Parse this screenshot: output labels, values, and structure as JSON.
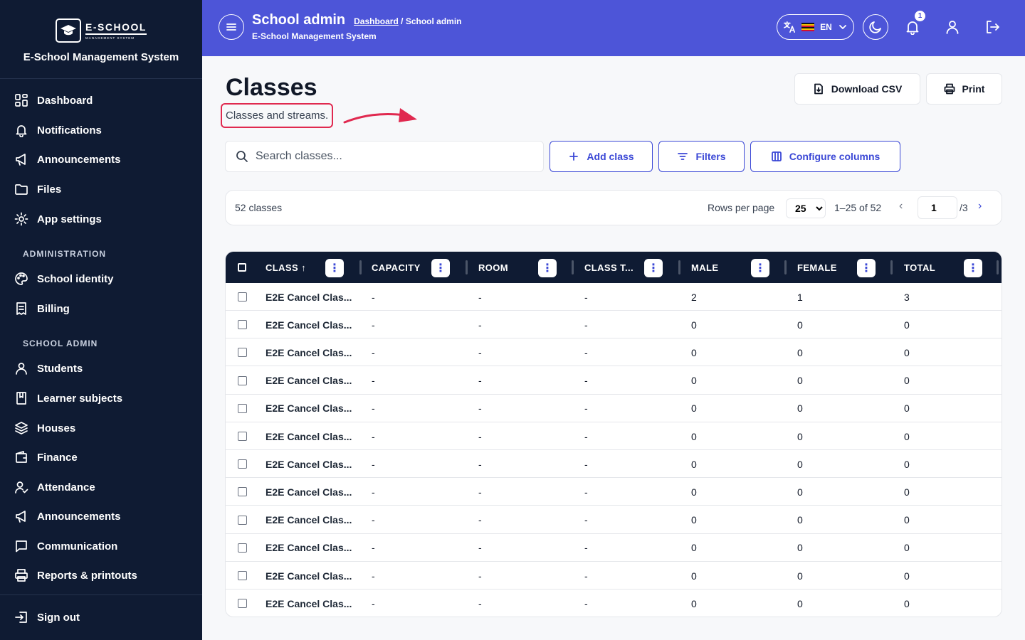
{
  "sidebar": {
    "logo_main": "E-SCHOOL",
    "logo_sub": "MANAGEMENT SYSTEM",
    "system_name": "E-School Management System",
    "items_main": [
      {
        "label": "Dashboard",
        "icon": "dashboard-icon"
      },
      {
        "label": "Notifications",
        "icon": "bell-icon"
      },
      {
        "label": "Announcements",
        "icon": "megaphone-icon"
      },
      {
        "label": "Files",
        "icon": "folder-icon"
      },
      {
        "label": "App settings",
        "icon": "gear-icon"
      }
    ],
    "section_admin": "ADMINISTRATION",
    "items_admin": [
      {
        "label": "School identity",
        "icon": "palette-icon"
      },
      {
        "label": "Billing",
        "icon": "receipt-icon"
      }
    ],
    "section_school": "SCHOOL ADMIN",
    "items_school": [
      {
        "label": "Students",
        "icon": "user-icon"
      },
      {
        "label": "Learner subjects",
        "icon": "book-icon"
      },
      {
        "label": "Houses",
        "icon": "layers-icon"
      },
      {
        "label": "Finance",
        "icon": "wallet-icon"
      },
      {
        "label": "Attendance",
        "icon": "user-check-icon"
      },
      {
        "label": "Announcements",
        "icon": "megaphone-icon"
      },
      {
        "label": "Communication",
        "icon": "message-icon"
      },
      {
        "label": "Reports & printouts",
        "icon": "printer-icon"
      }
    ],
    "sign_out": "Sign out"
  },
  "topbar": {
    "title": "School admin",
    "breadcrumb_link": "Dashboard",
    "breadcrumb_current": " / School admin",
    "subtitle": "E-School Management System",
    "language": "EN",
    "notification_count": "1",
    "accent_color": "#4d55d8"
  },
  "main": {
    "title": "Classes",
    "subtitle": "Classes and streams.",
    "download_csv": "Download CSV",
    "print": "Print",
    "search_placeholder": "Search classes...",
    "add_class": "Add class",
    "filters": "Filters",
    "configure_columns": "Configure columns"
  },
  "pager": {
    "count": "52 classes",
    "rows_per_page_label": "Rows per page",
    "rows_per_page": "25",
    "range": "1–25 of 52",
    "page": "1",
    "total_pages": "/3"
  },
  "table": {
    "columns": [
      "CLASS ↑",
      "CAPACITY",
      "ROOM",
      "CLASS T...",
      "MALE",
      "FEMALE",
      "TOTAL"
    ],
    "rows": [
      [
        "E2E Cancel Clas...",
        "-",
        "-",
        "-",
        "2",
        "1",
        "3"
      ],
      [
        "E2E Cancel Clas...",
        "-",
        "-",
        "-",
        "0",
        "0",
        "0"
      ],
      [
        "E2E Cancel Clas...",
        "-",
        "-",
        "-",
        "0",
        "0",
        "0"
      ],
      [
        "E2E Cancel Clas...",
        "-",
        "-",
        "-",
        "0",
        "0",
        "0"
      ],
      [
        "E2E Cancel Clas...",
        "-",
        "-",
        "-",
        "0",
        "0",
        "0"
      ],
      [
        "E2E Cancel Clas...",
        "-",
        "-",
        "-",
        "0",
        "0",
        "0"
      ],
      [
        "E2E Cancel Clas...",
        "-",
        "-",
        "-",
        "0",
        "0",
        "0"
      ],
      [
        "E2E Cancel Clas...",
        "-",
        "-",
        "-",
        "0",
        "0",
        "0"
      ],
      [
        "E2E Cancel Clas...",
        "-",
        "-",
        "-",
        "0",
        "0",
        "0"
      ],
      [
        "E2E Cancel Clas...",
        "-",
        "-",
        "-",
        "0",
        "0",
        "0"
      ],
      [
        "E2E Cancel Clas...",
        "-",
        "-",
        "-",
        "0",
        "0",
        "0"
      ],
      [
        "E2E Cancel Clas...",
        "-",
        "-",
        "-",
        "0",
        "0",
        "0"
      ]
    ]
  }
}
